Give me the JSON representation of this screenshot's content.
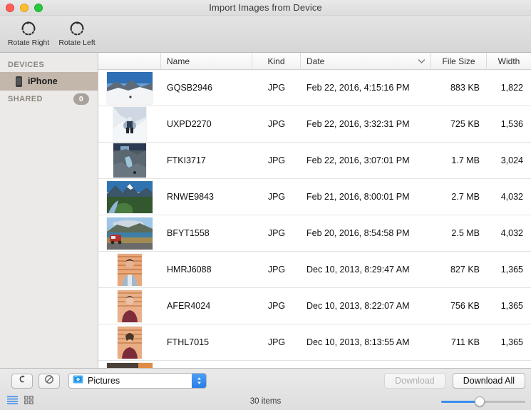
{
  "window": {
    "title": "Import Images from Device",
    "traffic_lights": [
      "close-button",
      "minimize-button",
      "zoom-button"
    ]
  },
  "toolbar": {
    "buttons": [
      {
        "label": "Rotate Right",
        "icon": "rotate-right-icon"
      },
      {
        "label": "Rotate Left",
        "icon": "rotate-left-icon"
      }
    ]
  },
  "sidebar": {
    "sections": [
      {
        "title": "DEVICES",
        "badge": "",
        "items": [
          {
            "label": "iPhone",
            "icon": "iphone-icon",
            "selected": true
          }
        ]
      },
      {
        "title": "SHARED",
        "badge": "0",
        "items": []
      }
    ]
  },
  "columns": [
    {
      "key": "thumb",
      "label": ""
    },
    {
      "key": "name",
      "label": "Name"
    },
    {
      "key": "kind",
      "label": "Kind"
    },
    {
      "key": "date",
      "label": "Date",
      "sorted": true,
      "sort_icon": "chevron-down-icon"
    },
    {
      "key": "size",
      "label": "File Size"
    },
    {
      "key": "width",
      "label": "Width"
    }
  ],
  "rows": [
    {
      "name": "GQSB2946",
      "kind": "JPG",
      "date": "Feb 22, 2016, 4:15:16 PM",
      "size": "883 KB",
      "width": "1,822",
      "thumb": "snowy-mountain-photo",
      "orient": "land"
    },
    {
      "name": "UXPD2270",
      "kind": "JPG",
      "date": "Feb 22, 2016, 3:32:31 PM",
      "size": "725 KB",
      "width": "1,536",
      "thumb": "climber-on-snow-photo",
      "orient": "tall"
    },
    {
      "name": "FTKI3717",
      "kind": "JPG",
      "date": "Feb 22, 2016, 3:07:01 PM",
      "size": "1.7 MB",
      "width": "3,024",
      "thumb": "glacier-crevasse-photo",
      "orient": "tall"
    },
    {
      "name": "RNWE9843",
      "kind": "JPG",
      "date": "Feb 21, 2016, 8:00:01 PM",
      "size": "2.7 MB",
      "width": "4,032",
      "thumb": "mountain-valley-river-photo",
      "orient": "land"
    },
    {
      "name": "BFYT1558",
      "kind": "JPG",
      "date": "Feb 20, 2016, 8:54:58 PM",
      "size": "2.5 MB",
      "width": "4,032",
      "thumb": "red-van-by-lake-photo",
      "orient": "land"
    },
    {
      "name": "HMRJ6088",
      "kind": "JPG",
      "date": "Dec 10, 2013, 8:29:47 AM",
      "size": "827 KB",
      "width": "1,365",
      "thumb": "portrait-man-blue-shirt-photo",
      "orient": "port"
    },
    {
      "name": "AFER4024",
      "kind": "JPG",
      "date": "Dec 10, 2013, 8:22:07 AM",
      "size": "756 KB",
      "width": "1,365",
      "thumb": "portrait-person-maroon-photo",
      "orient": "port"
    },
    {
      "name": "FTHL7015",
      "kind": "JPG",
      "date": "Dec 10, 2013, 8:13:55 AM",
      "size": "711 KB",
      "width": "1,365",
      "thumb": "portrait-person-maroon-2-photo",
      "orient": "port"
    }
  ],
  "bottom": {
    "rotate_button_icon": "rotate-icon",
    "delete_button_icon": "prohibit-icon",
    "destination": {
      "label": "Pictures",
      "icon": "pictures-folder-icon",
      "stepper_icon": "stepper-updown-icon"
    },
    "download_label": "Download",
    "download_enabled": false,
    "download_all_label": "Download All",
    "download_all_enabled": true,
    "view_list_icon": "list-view-icon",
    "view_grid_icon": "grid-view-icon",
    "active_view": "list",
    "item_count": "30 items",
    "zoom_slider_percent": 45
  },
  "colors": {
    "accent_blue": "#3b8ef0",
    "sidebar_bg": "#eceae8",
    "selection": "#c3b6ab",
    "badge": "#a9a29b"
  }
}
